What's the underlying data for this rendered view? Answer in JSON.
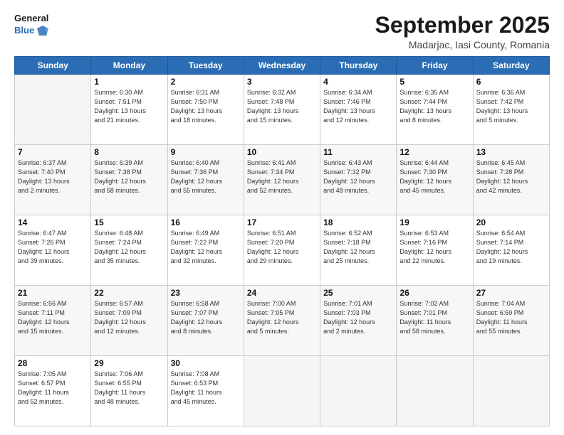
{
  "header": {
    "logo_line1": "General",
    "logo_line2": "Blue",
    "month": "September 2025",
    "location": "Madarjac, Iasi County, Romania"
  },
  "days_of_week": [
    "Sunday",
    "Monday",
    "Tuesday",
    "Wednesday",
    "Thursday",
    "Friday",
    "Saturday"
  ],
  "weeks": [
    [
      {
        "day": "",
        "info": ""
      },
      {
        "day": "1",
        "info": "Sunrise: 6:30 AM\nSunset: 7:51 PM\nDaylight: 13 hours\nand 21 minutes."
      },
      {
        "day": "2",
        "info": "Sunrise: 6:31 AM\nSunset: 7:50 PM\nDaylight: 13 hours\nand 18 minutes."
      },
      {
        "day": "3",
        "info": "Sunrise: 6:32 AM\nSunset: 7:48 PM\nDaylight: 13 hours\nand 15 minutes."
      },
      {
        "day": "4",
        "info": "Sunrise: 6:34 AM\nSunset: 7:46 PM\nDaylight: 13 hours\nand 12 minutes."
      },
      {
        "day": "5",
        "info": "Sunrise: 6:35 AM\nSunset: 7:44 PM\nDaylight: 13 hours\nand 8 minutes."
      },
      {
        "day": "6",
        "info": "Sunrise: 6:36 AM\nSunset: 7:42 PM\nDaylight: 13 hours\nand 5 minutes."
      }
    ],
    [
      {
        "day": "7",
        "info": "Sunrise: 6:37 AM\nSunset: 7:40 PM\nDaylight: 13 hours\nand 2 minutes."
      },
      {
        "day": "8",
        "info": "Sunrise: 6:39 AM\nSunset: 7:38 PM\nDaylight: 12 hours\nand 58 minutes."
      },
      {
        "day": "9",
        "info": "Sunrise: 6:40 AM\nSunset: 7:36 PM\nDaylight: 12 hours\nand 55 minutes."
      },
      {
        "day": "10",
        "info": "Sunrise: 6:41 AM\nSunset: 7:34 PM\nDaylight: 12 hours\nand 52 minutes."
      },
      {
        "day": "11",
        "info": "Sunrise: 6:43 AM\nSunset: 7:32 PM\nDaylight: 12 hours\nand 48 minutes."
      },
      {
        "day": "12",
        "info": "Sunrise: 6:44 AM\nSunset: 7:30 PM\nDaylight: 12 hours\nand 45 minutes."
      },
      {
        "day": "13",
        "info": "Sunrise: 6:45 AM\nSunset: 7:28 PM\nDaylight: 12 hours\nand 42 minutes."
      }
    ],
    [
      {
        "day": "14",
        "info": "Sunrise: 6:47 AM\nSunset: 7:26 PM\nDaylight: 12 hours\nand 39 minutes."
      },
      {
        "day": "15",
        "info": "Sunrise: 6:48 AM\nSunset: 7:24 PM\nDaylight: 12 hours\nand 35 minutes."
      },
      {
        "day": "16",
        "info": "Sunrise: 6:49 AM\nSunset: 7:22 PM\nDaylight: 12 hours\nand 32 minutes."
      },
      {
        "day": "17",
        "info": "Sunrise: 6:51 AM\nSunset: 7:20 PM\nDaylight: 12 hours\nand 29 minutes."
      },
      {
        "day": "18",
        "info": "Sunrise: 6:52 AM\nSunset: 7:18 PM\nDaylight: 12 hours\nand 25 minutes."
      },
      {
        "day": "19",
        "info": "Sunrise: 6:53 AM\nSunset: 7:16 PM\nDaylight: 12 hours\nand 22 minutes."
      },
      {
        "day": "20",
        "info": "Sunrise: 6:54 AM\nSunset: 7:14 PM\nDaylight: 12 hours\nand 19 minutes."
      }
    ],
    [
      {
        "day": "21",
        "info": "Sunrise: 6:56 AM\nSunset: 7:11 PM\nDaylight: 12 hours\nand 15 minutes."
      },
      {
        "day": "22",
        "info": "Sunrise: 6:57 AM\nSunset: 7:09 PM\nDaylight: 12 hours\nand 12 minutes."
      },
      {
        "day": "23",
        "info": "Sunrise: 6:58 AM\nSunset: 7:07 PM\nDaylight: 12 hours\nand 8 minutes."
      },
      {
        "day": "24",
        "info": "Sunrise: 7:00 AM\nSunset: 7:05 PM\nDaylight: 12 hours\nand 5 minutes."
      },
      {
        "day": "25",
        "info": "Sunrise: 7:01 AM\nSunset: 7:03 PM\nDaylight: 12 hours\nand 2 minutes."
      },
      {
        "day": "26",
        "info": "Sunrise: 7:02 AM\nSunset: 7:01 PM\nDaylight: 11 hours\nand 58 minutes."
      },
      {
        "day": "27",
        "info": "Sunrise: 7:04 AM\nSunset: 6:59 PM\nDaylight: 11 hours\nand 55 minutes."
      }
    ],
    [
      {
        "day": "28",
        "info": "Sunrise: 7:05 AM\nSunset: 6:57 PM\nDaylight: 11 hours\nand 52 minutes."
      },
      {
        "day": "29",
        "info": "Sunrise: 7:06 AM\nSunset: 6:55 PM\nDaylight: 11 hours\nand 48 minutes."
      },
      {
        "day": "30",
        "info": "Sunrise: 7:08 AM\nSunset: 6:53 PM\nDaylight: 11 hours\nand 45 minutes."
      },
      {
        "day": "",
        "info": ""
      },
      {
        "day": "",
        "info": ""
      },
      {
        "day": "",
        "info": ""
      },
      {
        "day": "",
        "info": ""
      }
    ]
  ]
}
